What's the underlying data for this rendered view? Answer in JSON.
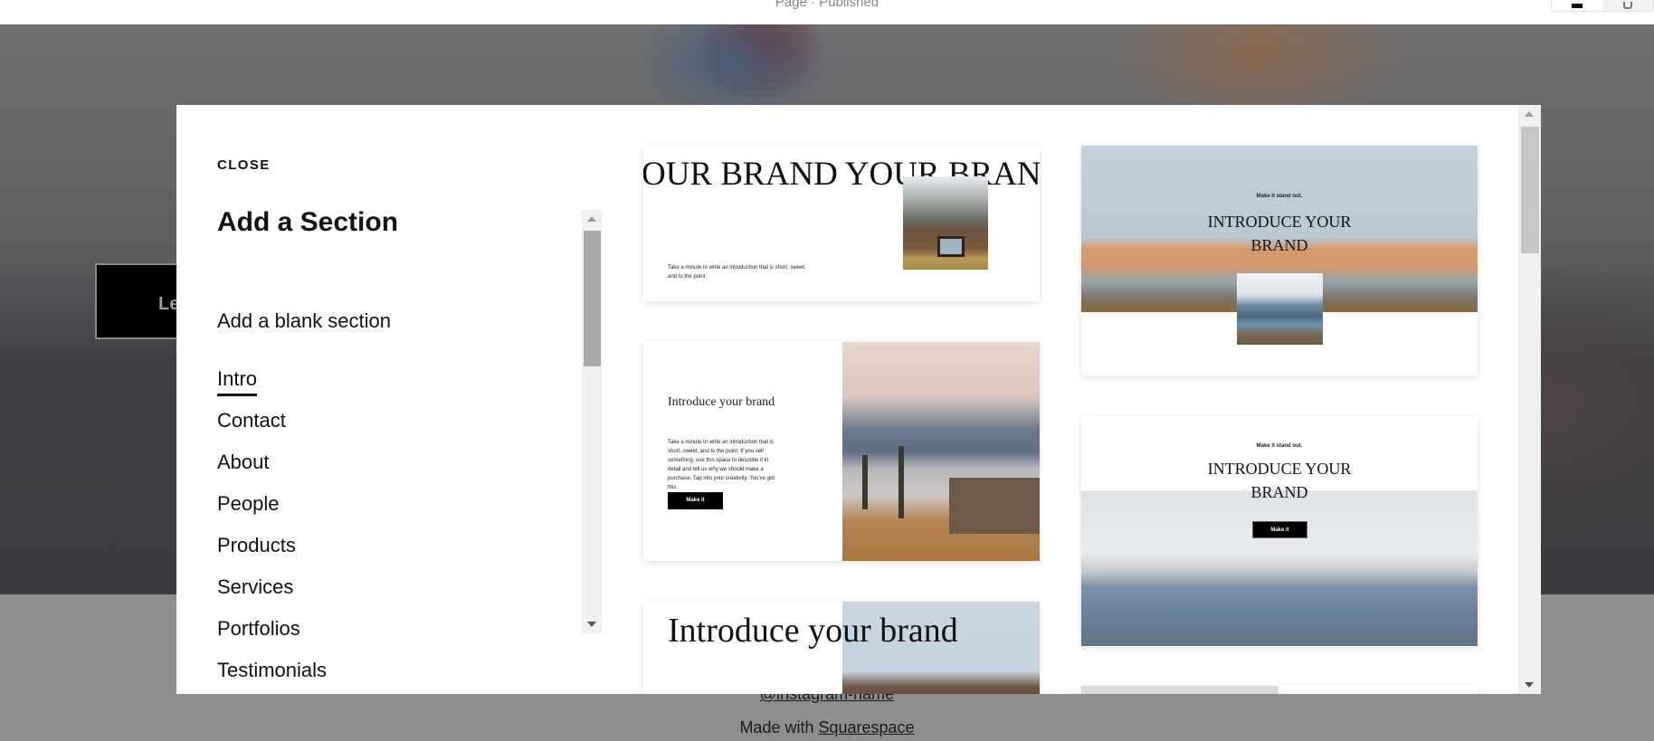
{
  "topbar": {
    "status": "Page · Published",
    "view_toggle": [
      {
        "icon": "desktop-icon",
        "active": true
      },
      {
        "icon": "mobile-icon",
        "active": false
      }
    ]
  },
  "background_page": {
    "button_partial_label": "Le",
    "footer_instagram": "@instagram-name",
    "footer_made_with_prefix": "Made with ",
    "footer_made_with_link": "Squarespace"
  },
  "modal": {
    "close_label": "CLOSE",
    "title": "Add a Section",
    "blank_section_label": "Add a blank section",
    "categories": [
      {
        "label": "Intro",
        "active": true
      },
      {
        "label": "Contact",
        "active": false
      },
      {
        "label": "About",
        "active": false
      },
      {
        "label": "People",
        "active": false
      },
      {
        "label": "Products",
        "active": false
      },
      {
        "label": "Services",
        "active": false
      },
      {
        "label": "Portfolios",
        "active": false
      },
      {
        "label": "Testimonials",
        "active": false
      }
    ],
    "templates": [
      {
        "marquee": "OUR BRAND  YOUR BRAN",
        "body": "Take a minute to write an introduction that is short, sweet, and to the point."
      },
      {
        "heading": "Introduce your brand",
        "body": "Take a minute to write an introduction that is short, sweet, and to the point. If you sell something, use this space to describe it in detail and tell us why we should make a purchase. Tap into your creativity. You've got this.",
        "button": "Make it"
      },
      {
        "heading": "Introduce your brand"
      },
      {
        "kicker": "Make it stand out.",
        "heading": "INTRODUCE YOUR BRAND"
      },
      {
        "kicker": "Make it stand out.",
        "heading": "INTRODUCE YOUR BRAND",
        "button": "Make it"
      }
    ]
  }
}
